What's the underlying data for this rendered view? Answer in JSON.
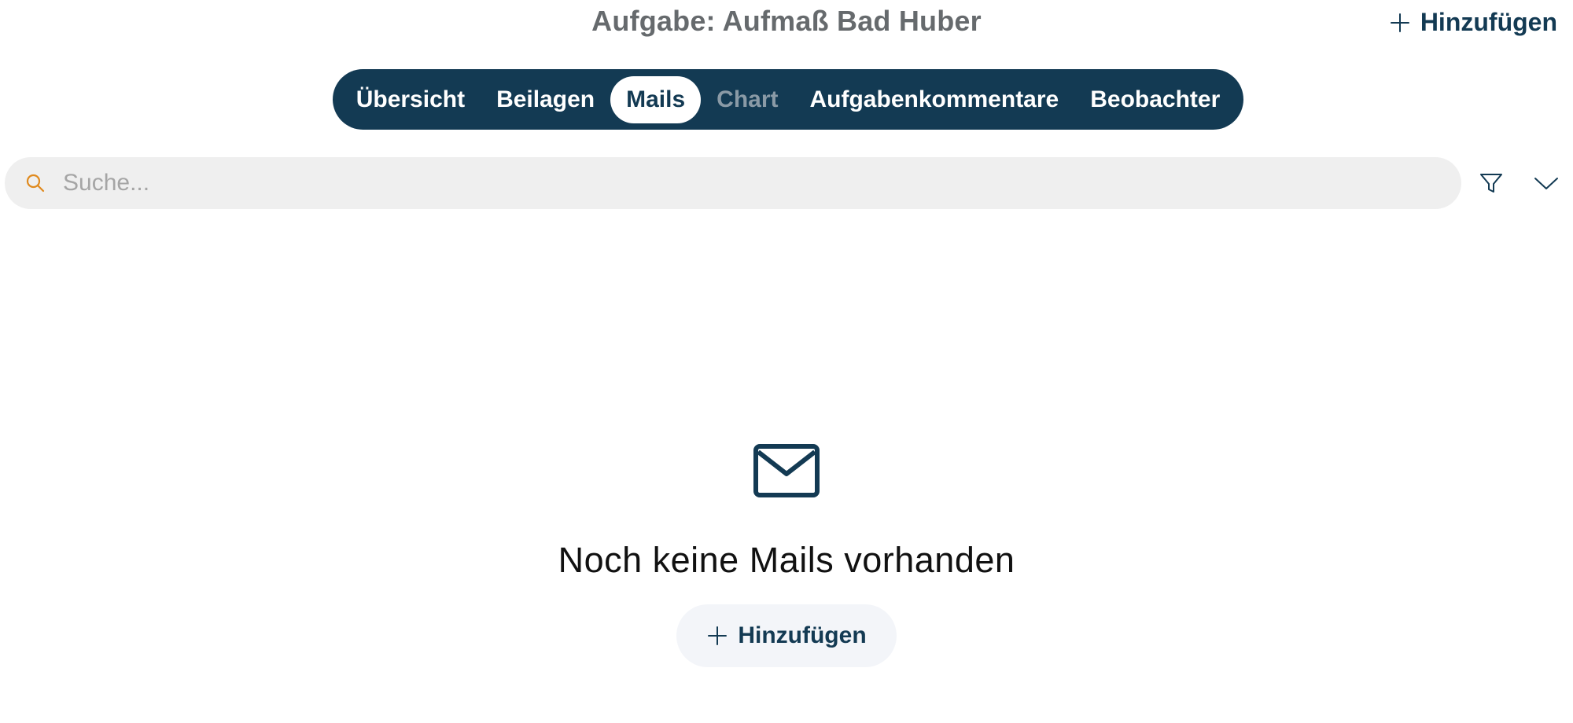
{
  "header": {
    "title": "Aufgabe: Aufmaß Bad Huber",
    "add_label": "Hinzufügen"
  },
  "tabs": [
    {
      "label": "Übersicht",
      "state": "normal"
    },
    {
      "label": "Beilagen",
      "state": "normal"
    },
    {
      "label": "Mails",
      "state": "active"
    },
    {
      "label": "Chart",
      "state": "disabled"
    },
    {
      "label": "Aufgabenkommentare",
      "state": "normal"
    },
    {
      "label": "Beobachter",
      "state": "normal"
    }
  ],
  "search": {
    "placeholder": "Suche...",
    "value": "",
    "icon": "search-icon"
  },
  "toolbar": {
    "filter_icon": "filter-icon",
    "expand_icon": "chevron-down-icon"
  },
  "empty_state": {
    "icon": "mail-icon",
    "message": "Noch keine Mails vorhanden",
    "add_label": "Hinzufügen"
  },
  "colors": {
    "primary": "#133a53",
    "title_gray": "#666a6d",
    "search_bg": "#efefef",
    "search_icon": "#e08a1e",
    "disabled_tab": "#8a9aa6",
    "button_bg": "#f3f5f9"
  }
}
